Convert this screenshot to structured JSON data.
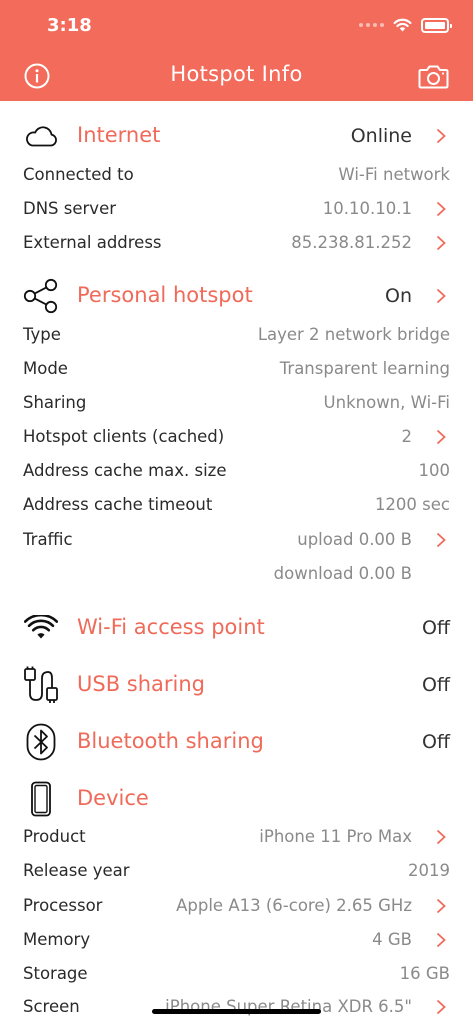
{
  "status": {
    "time": "3:18"
  },
  "nav": {
    "title": "Hotspot Info"
  },
  "internet": {
    "title": "Internet",
    "value": "Online",
    "rows": [
      {
        "label": "Connected to",
        "value": "Wi-Fi network"
      },
      {
        "label": "DNS server",
        "value": "10.10.10.1"
      },
      {
        "label": "External address",
        "value": "85.238.81.252"
      }
    ]
  },
  "hotspot": {
    "title": "Personal hotspot",
    "value": "On",
    "rows": [
      {
        "label": "Type",
        "value": "Layer 2 network bridge"
      },
      {
        "label": "Mode",
        "value": "Transparent learning"
      },
      {
        "label": "Sharing",
        "value": "Unknown, Wi-Fi"
      },
      {
        "label": "Hotspot clients (cached)",
        "value": "2"
      },
      {
        "label": "Address cache max. size",
        "value": "100"
      },
      {
        "label": "Address cache timeout",
        "value": "1200 sec"
      },
      {
        "label": "Traffic",
        "value": "upload 0.00 B"
      },
      {
        "label": "",
        "value": "download 0.00 B"
      }
    ]
  },
  "wifi": {
    "title": "Wi-Fi access point",
    "value": "Off"
  },
  "usb": {
    "title": "USB sharing",
    "value": "Off"
  },
  "bluetooth": {
    "title": "Bluetooth sharing",
    "value": "Off"
  },
  "device": {
    "title": "Device",
    "rows": [
      {
        "label": "Product",
        "value": "iPhone 11 Pro Max"
      },
      {
        "label": "Release year",
        "value": "2019"
      },
      {
        "label": "Processor",
        "value": "Apple A13 (6-core) 2.65 GHz"
      },
      {
        "label": "Memory",
        "value": "4 GB"
      },
      {
        "label": "Storage",
        "value": "16 GB"
      },
      {
        "label": "Screen",
        "value": "iPhone Super Retina XDR 6.5\""
      }
    ]
  },
  "colors": {
    "accent": "#f26b5b",
    "section_title": "#f06a5a",
    "value_gray": "#8a8a8a"
  },
  "icons": [
    "info-icon",
    "camera-icon",
    "cloud-icon",
    "share-icon",
    "wifi-icon",
    "usb-icon",
    "bluetooth-icon",
    "phone-icon",
    "chevron-right-icon"
  ]
}
